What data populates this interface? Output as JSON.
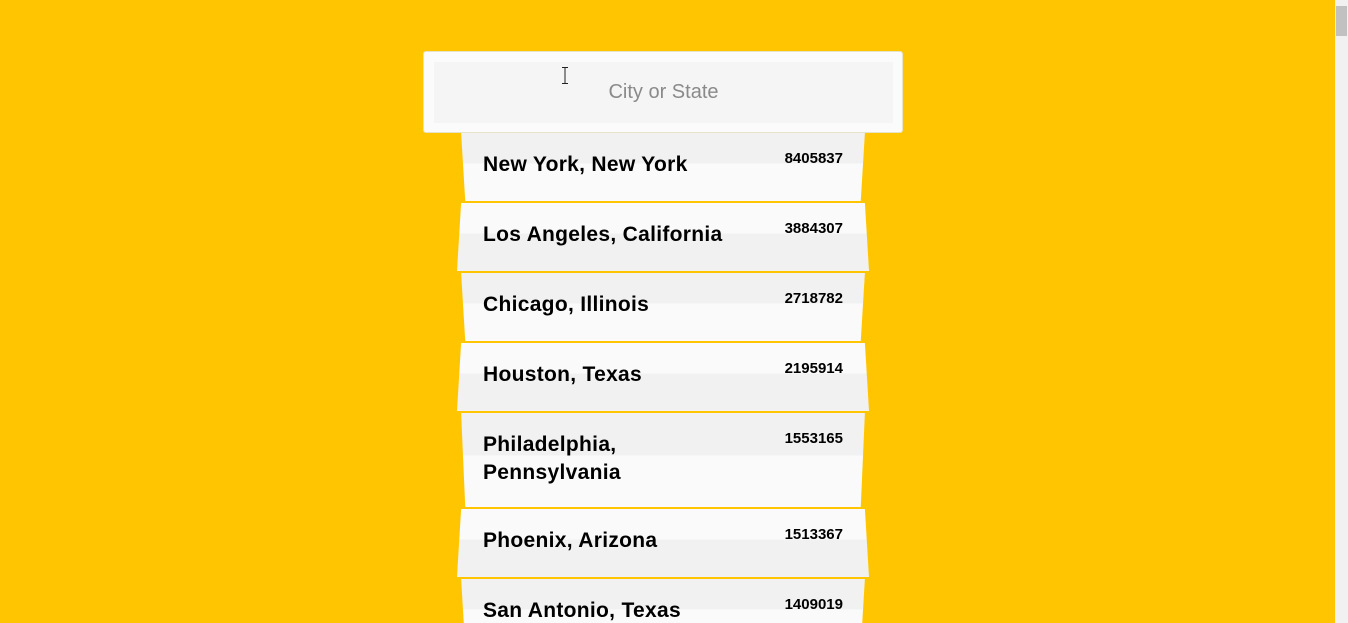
{
  "search": {
    "placeholder": "City or State",
    "value": ""
  },
  "suggestions": [
    {
      "name": "New York, New York",
      "population": "8405837"
    },
    {
      "name": "Los Angeles, California",
      "population": "3884307"
    },
    {
      "name": "Chicago, Illinois",
      "population": "2718782"
    },
    {
      "name": "Houston, Texas",
      "population": "2195914"
    },
    {
      "name": "Philadelphia, Pennsylvania",
      "population": "1553165"
    },
    {
      "name": "Phoenix, Arizona",
      "population": "1513367"
    },
    {
      "name": "San Antonio, Texas",
      "population": "1409019"
    }
  ],
  "colors": {
    "background": "#ffc600",
    "panel": "#fbfbfb"
  },
  "icons": {
    "cursor": "text-cursor-icon"
  }
}
